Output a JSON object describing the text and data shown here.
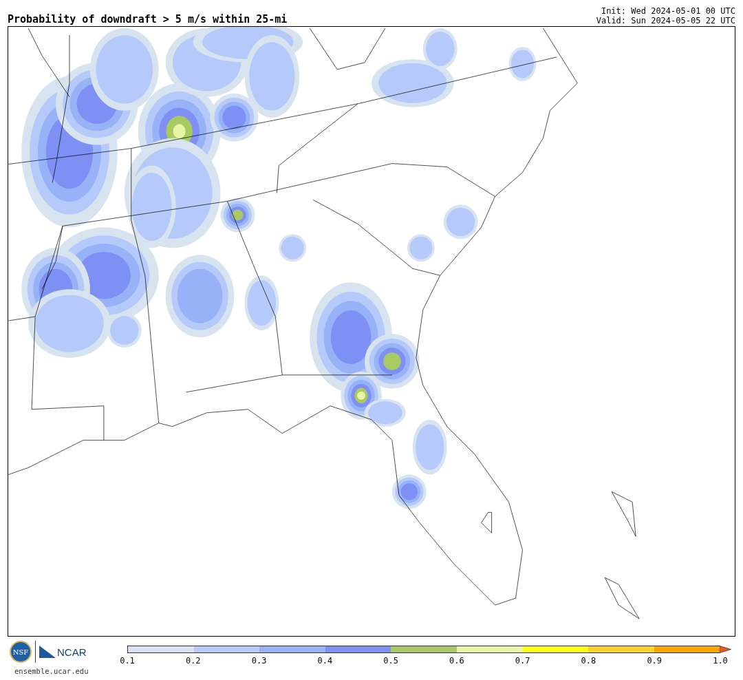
{
  "title": "Probability of downdraft > 5 m/s within 25-mi",
  "init": "Init: Wed 2024-05-01 00 UTC",
  "valid": "Valid: Sun 2024-05-05 22 UTC",
  "logos": {
    "nsf": "NSF",
    "ncar": "NCAR",
    "site": "ensemble.ucar.edu"
  },
  "colorbar": {
    "bins": [
      {
        "color": "#d7e3ee"
      },
      {
        "color": "#b5cafa"
      },
      {
        "color": "#98b2f7"
      },
      {
        "color": "#7e90f3"
      },
      {
        "color": "#a7cb62"
      },
      {
        "color": "#e8f5a6"
      },
      {
        "color": "#ffff1a"
      },
      {
        "color": "#ffd12a"
      },
      {
        "color": "#ffa500"
      }
    ],
    "extend_arrow": {
      "color": "#f05a0a"
    },
    "ticks": [
      "0.1",
      "0.2",
      "0.3",
      "0.4",
      "0.5",
      "0.6",
      "0.7",
      "0.8",
      "0.9",
      "1.0"
    ]
  }
}
